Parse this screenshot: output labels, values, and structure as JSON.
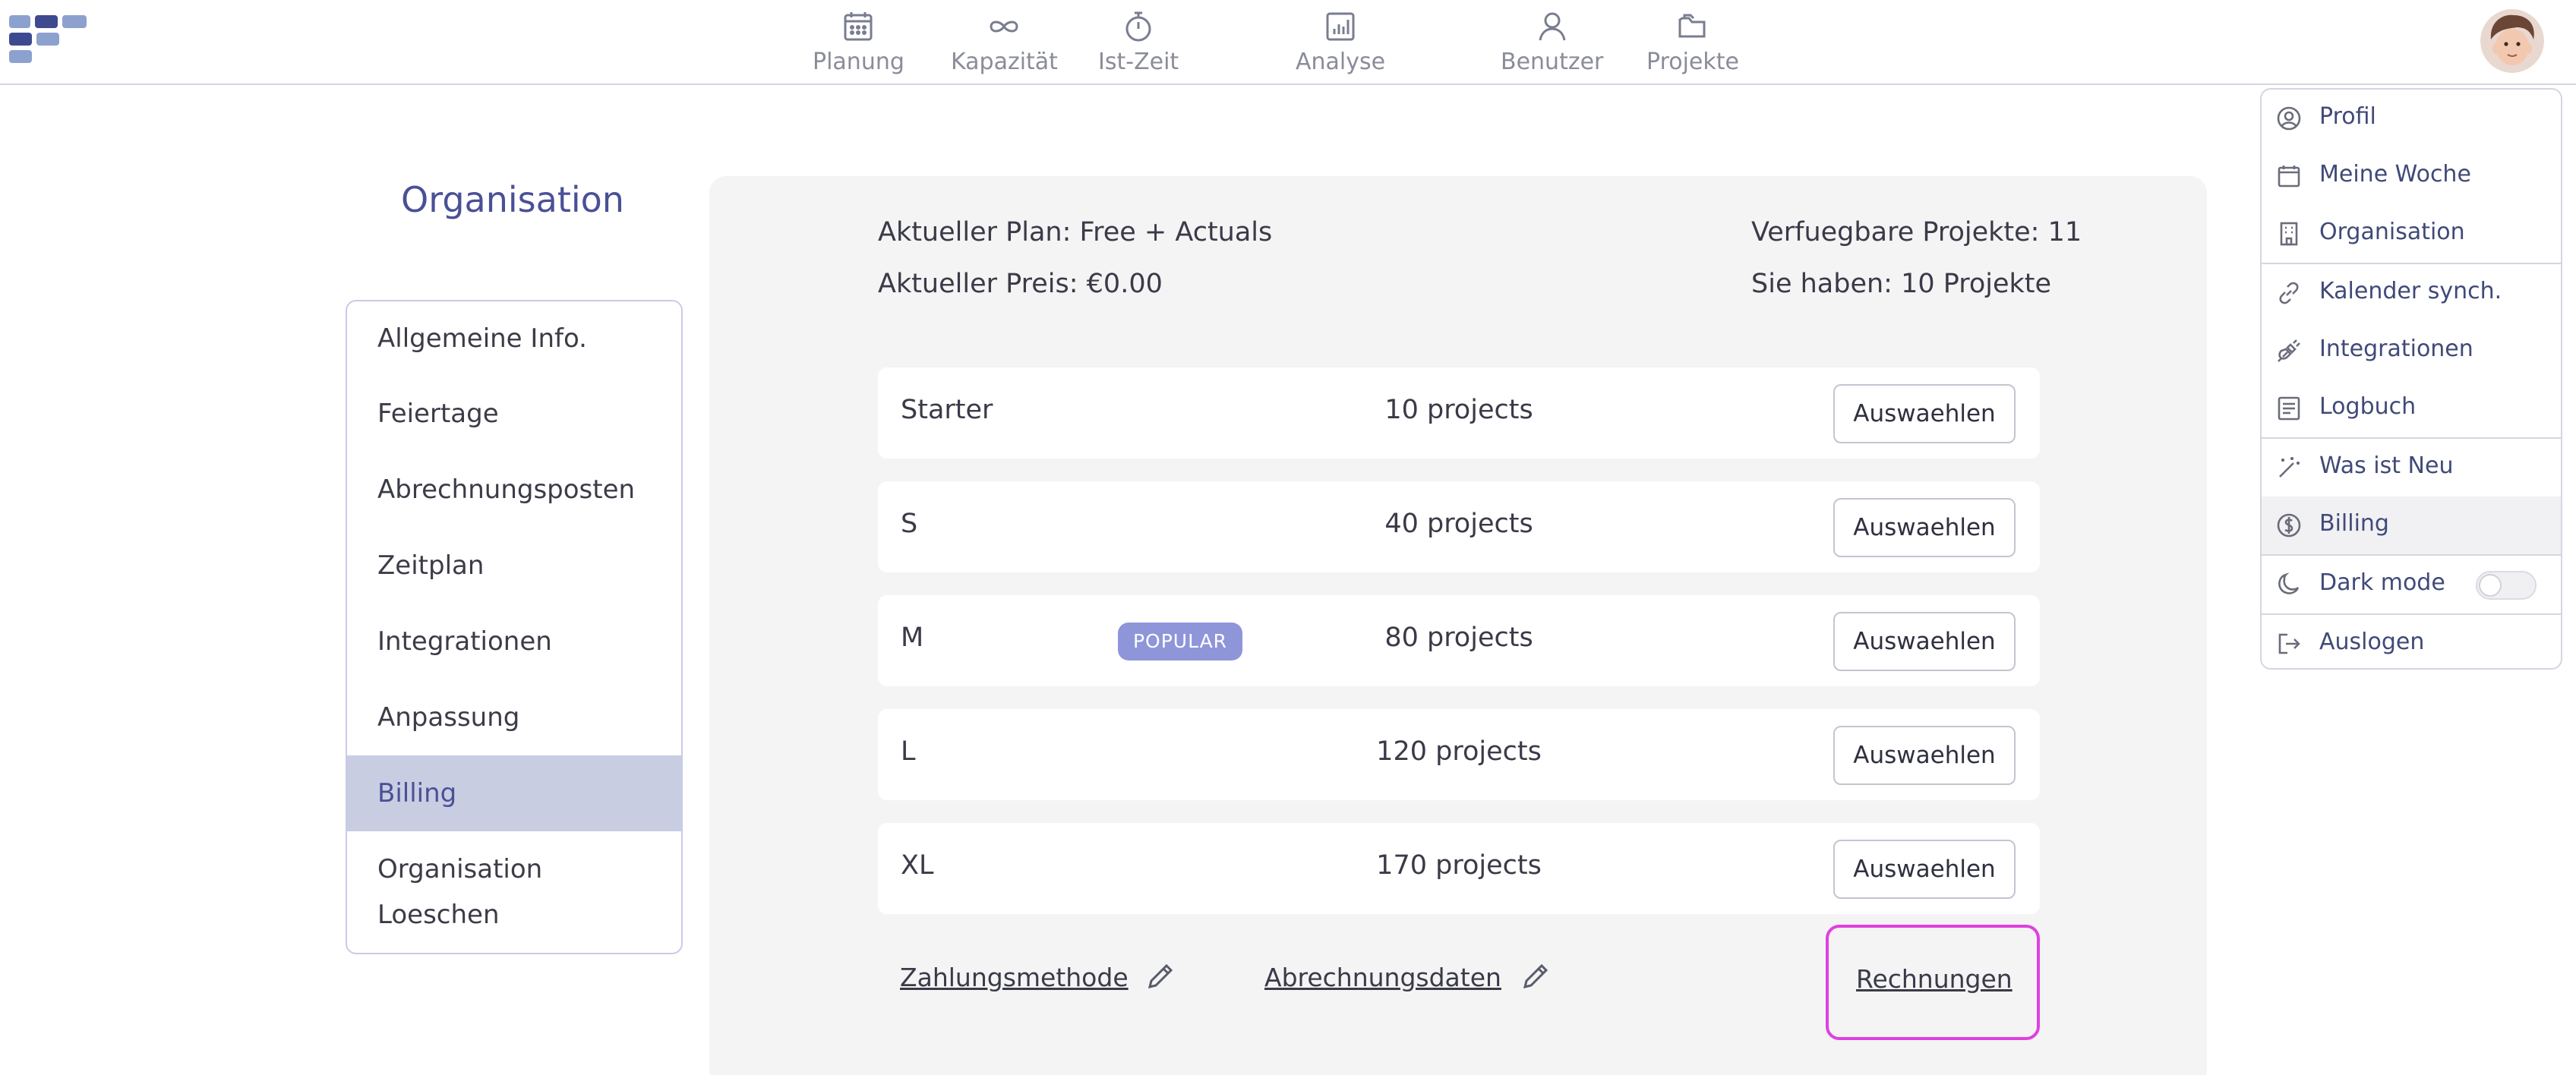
{
  "nav": {
    "items": [
      {
        "label": "Planung",
        "icon": "calendar-icon"
      },
      {
        "label": "Kapazität",
        "icon": "infinity-icon"
      },
      {
        "label": "Ist-Zeit",
        "icon": "stopwatch-icon"
      },
      {
        "label": "Analyse",
        "icon": "bar-chart-icon"
      },
      {
        "label": "Benutzer",
        "icon": "user-icon"
      },
      {
        "label": "Projekte",
        "icon": "folder-icon"
      }
    ]
  },
  "sidebar": {
    "title": "Organisation",
    "items": [
      {
        "label": "Allgemeine Info."
      },
      {
        "label": "Feiertage"
      },
      {
        "label": "Abrechnungsposten"
      },
      {
        "label": "Zeitplan"
      },
      {
        "label": "Integrationen"
      },
      {
        "label": "Anpassung"
      },
      {
        "label": "Billing",
        "active": true
      },
      {
        "label": "Organisation",
        "label2": "Loeschen"
      }
    ]
  },
  "billing": {
    "current_plan": "Aktueller Plan: Free + Actuals",
    "current_price": "Aktueller Preis: €0.00",
    "available_projects": "Verfuegbare Projekte: 11",
    "you_have": "Sie haben: 10 Projekte",
    "plans": [
      {
        "name": "Starter",
        "projects": "10 projects",
        "button": "Auswaehlen"
      },
      {
        "name": "S",
        "projects": "40 projects",
        "button": "Auswaehlen"
      },
      {
        "name": "M",
        "projects": "80 projects",
        "button": "Auswaehlen",
        "badge": "POPULAR"
      },
      {
        "name": "L",
        "projects": "120 projects",
        "button": "Auswaehlen"
      },
      {
        "name": "XL",
        "projects": "170 projects",
        "button": "Auswaehlen"
      }
    ],
    "links": {
      "payment": "Zahlungsmethode",
      "billing_data": "Abrechnungsdaten",
      "invoices": "Rechnungen"
    }
  },
  "dropdown": {
    "items": [
      {
        "label": "Profil",
        "icon": "user-circle-icon"
      },
      {
        "label": "Meine Woche",
        "icon": "calendar-icon"
      },
      {
        "label": "Organisation",
        "icon": "building-icon"
      },
      {
        "label": "Kalender synch.",
        "icon": "link-icon"
      },
      {
        "label": "Integrationen",
        "icon": "plug-icon"
      },
      {
        "label": "Logbuch",
        "icon": "logbook-icon"
      },
      {
        "label": "Was ist Neu",
        "icon": "magic-wand-icon"
      },
      {
        "label": "Billing",
        "icon": "dollar-circle-icon",
        "active": true
      },
      {
        "label": "Dark mode",
        "icon": "moon-icon",
        "toggle": false
      },
      {
        "label": "Auslogen",
        "icon": "logout-icon"
      }
    ]
  },
  "colors": {
    "accent": "#4a5096",
    "active_bg": "#c8cde2",
    "badge": "#8f95d9",
    "highlight": "#e040e0"
  }
}
